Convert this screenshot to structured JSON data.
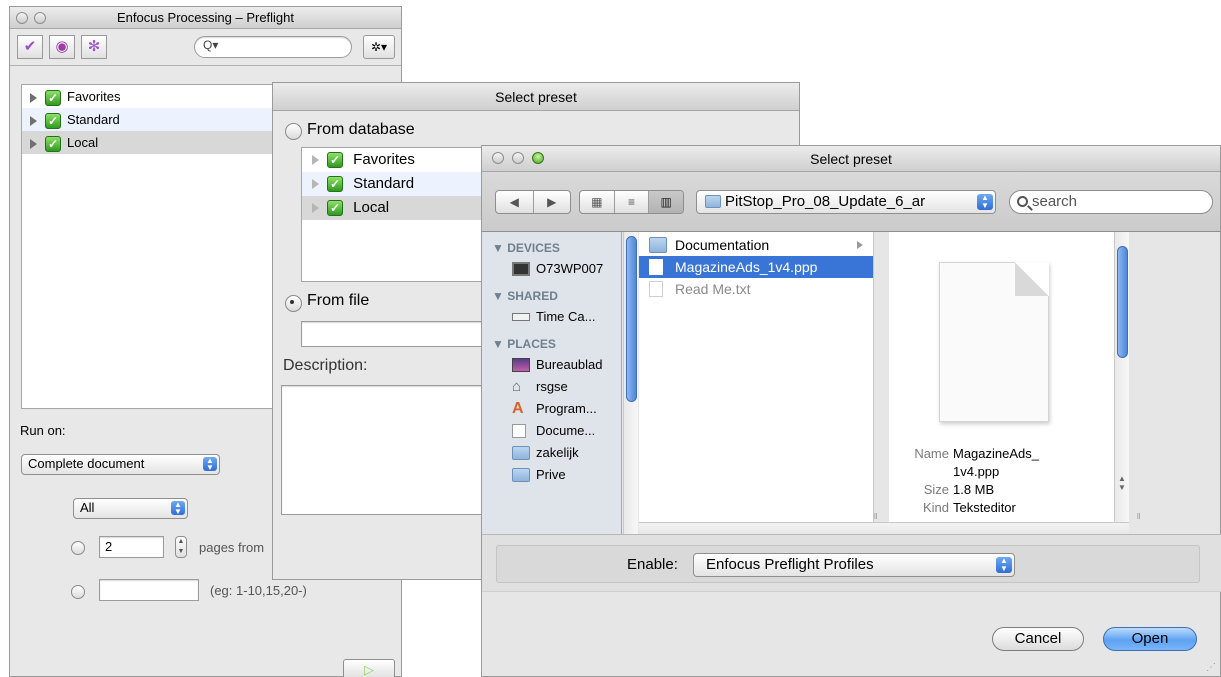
{
  "preflight": {
    "title": "Enfocus Processing – Preflight",
    "search_placeholder": "",
    "tree": [
      {
        "label": "Favorites"
      },
      {
        "label": "Standard"
      },
      {
        "label": "Local"
      }
    ],
    "run_on_label": "Run on:",
    "run_on_value": "Complete document",
    "pages_value": "All",
    "pages_count": "2",
    "pages_from_label": "pages from",
    "range_hint": "(eg: 1-10,15,20-)"
  },
  "preset_back": {
    "title": "Select preset",
    "from_database": "From database",
    "from_file": "From file",
    "description_label": "Description:",
    "tree": [
      {
        "label": "Favorites"
      },
      {
        "label": "Standard"
      },
      {
        "label": "Local"
      }
    ]
  },
  "preset_front": {
    "title": "Select preset",
    "path_popup": "PitStop_Pro_08_Update_6_ar",
    "search_placeholder": "search",
    "sidebar": {
      "devices_header": "▼ DEVICES",
      "devices": [
        "O73WP007"
      ],
      "shared_header": "▼ SHARED",
      "shared": [
        "Time Ca..."
      ],
      "places_header": "▼ PLACES",
      "places": [
        "Bureaublad",
        "rsgse",
        "Program...",
        "Docume...",
        "zakelijk",
        "Prive"
      ]
    },
    "files": [
      {
        "name": "Documentation"
      },
      {
        "name": "MagazineAds_1v4.ppp"
      },
      {
        "name": "Read Me.txt"
      }
    ],
    "info": {
      "name_key": "Name",
      "name_value_1": "MagazineAds_",
      "name_value_2": "1v4.ppp",
      "size_key": "Size",
      "size_value": "1.8 MB",
      "kind_key": "Kind",
      "kind_value": "Teksteditor"
    },
    "enable_label": "Enable:",
    "enable_value": "Enfocus Preflight Profiles",
    "cancel_label": "Cancel",
    "open_label": "Open"
  }
}
